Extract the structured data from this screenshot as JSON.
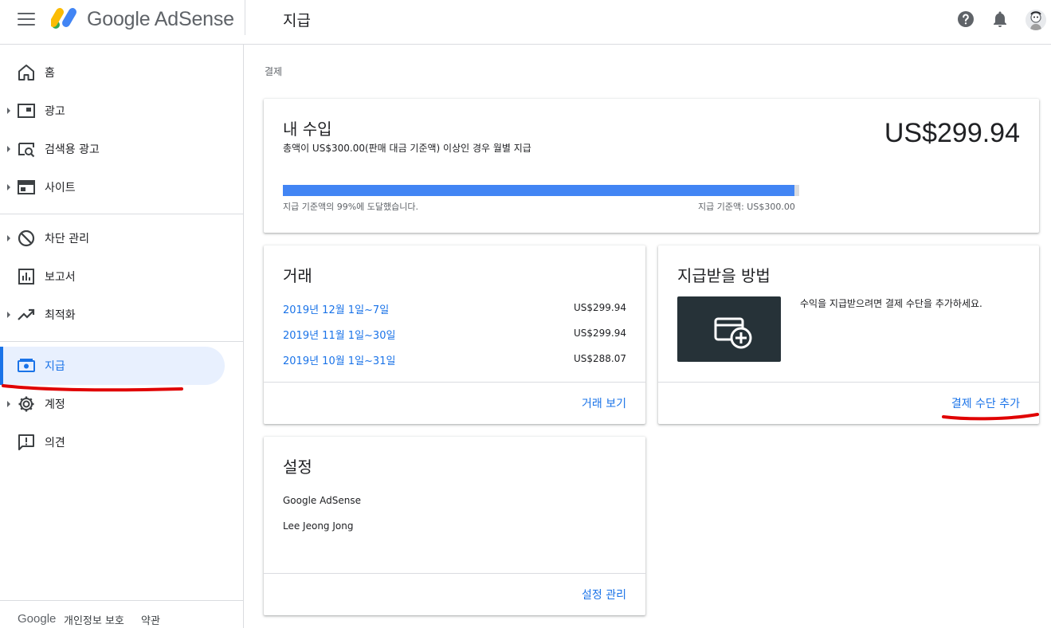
{
  "header": {
    "brand_google": "Google",
    "brand_product": "AdSense",
    "page_title": "지급"
  },
  "sidebar": {
    "items": [
      {
        "label": "홈",
        "icon": "home-icon"
      },
      {
        "label": "광고",
        "icon": "ads-icon"
      },
      {
        "label": "검색용 광고",
        "icon": "search-ads-icon"
      },
      {
        "label": "사이트",
        "icon": "sites-icon"
      },
      {
        "label": "차단 관리",
        "icon": "block-icon"
      },
      {
        "label": "보고서",
        "icon": "reports-icon"
      },
      {
        "label": "최적화",
        "icon": "trending-icon"
      },
      {
        "label": "지급",
        "icon": "payments-icon"
      },
      {
        "label": "계정",
        "icon": "gear-icon"
      },
      {
        "label": "의견",
        "icon": "feedback-icon"
      }
    ],
    "active_index": 7,
    "footer": {
      "logo": "Google",
      "privacy": "개인정보 보호",
      "terms": "약관"
    }
  },
  "main": {
    "breadcrumb": "결제",
    "earnings": {
      "title": "내 수입",
      "subtitle": "총액이 US$300.00(판매 대금 기준액) 이상인 경우 월별 지급",
      "amount": "US$299.94",
      "progress_percent": 99,
      "progress_label": "지급 기준액의 99%에 도달했습니다.",
      "threshold_label": "지급 기준액: US$300.00"
    },
    "transactions": {
      "title": "거래",
      "rows": [
        {
          "period": "2019년 12월 1일~7일",
          "amount": "US$299.94"
        },
        {
          "period": "2019년 11월 1일~30일",
          "amount": "US$299.94"
        },
        {
          "period": "2019년 10월 1일~31일",
          "amount": "US$288.07"
        }
      ],
      "action": "거래 보기"
    },
    "payment_method": {
      "title": "지급받을 방법",
      "description": "수익을 지급받으려면 결제 수단을 추가하세요.",
      "action": "결제 수단 추가"
    },
    "settings": {
      "title": "설정",
      "lines": [
        "Google AdSense",
        "Lee Jeong Jong"
      ],
      "action": "설정 관리"
    }
  },
  "colors": {
    "accent": "#1a73e8",
    "progress": "#4285f4",
    "annotation": "#e00000"
  }
}
